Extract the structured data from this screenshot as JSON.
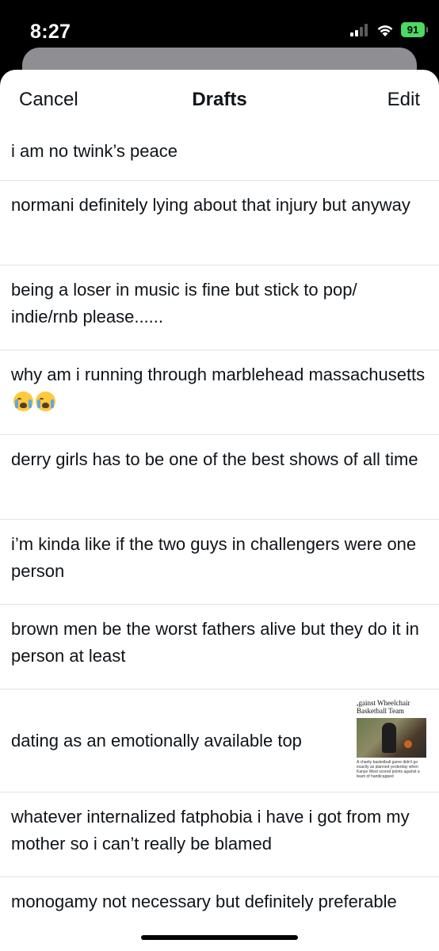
{
  "status_bar": {
    "time": "8:27",
    "battery": "91",
    "battery_color": "#4cd964"
  },
  "nav": {
    "cancel_label": "Cancel",
    "title": "Drafts",
    "edit_label": "Edit"
  },
  "drafts": [
    {
      "text": "i am no twink’s peace"
    },
    {
      "text": "normani definitely lying about that injury but anyway"
    },
    {
      "text": "being a loser in music is fine but stick to pop/ indie/rnb please......"
    },
    {
      "text": "why am i running through marblehead massachusetts",
      "emoji": "loudly-crying-face-icon"
    },
    {
      "text": "derry girls has to be one of the best shows of all time"
    },
    {
      "text": "i’m kinda like if the two guys in challengers were one person"
    },
    {
      "text": "brown men be the worst fathers alive but they do it in person at least"
    },
    {
      "text": "dating as an emotionally available top",
      "thumbnail": {
        "title": "ₐgainst Wheelchair Basketball Team",
        "caption": "A charity basketball game didn't go exactly as planned yesterday when Kanye West scored points against a team of handicapped"
      }
    },
    {
      "text": "whatever internalized fatphobia i have i got from my mother so i can’t really be blamed"
    },
    {
      "text": "monogamy not necessary but definitely preferable"
    }
  ],
  "colors": {
    "text": "#0f1419",
    "divider": "#e1e4e8",
    "sheet_background": "#ffffff",
    "screen_background": "#000000"
  }
}
